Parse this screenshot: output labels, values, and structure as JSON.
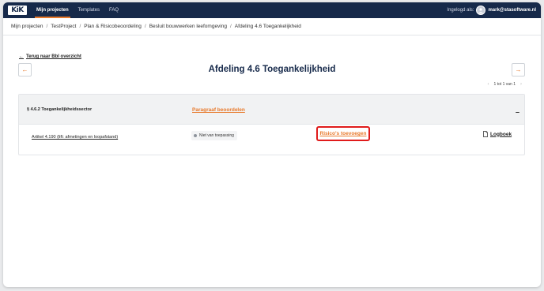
{
  "topbar": {
    "logo": "KiK",
    "nav": [
      {
        "label": "Mijn projecten",
        "active": true
      },
      {
        "label": "Templates",
        "active": false
      },
      {
        "label": "FAQ",
        "active": false
      }
    ],
    "logged_in_label": "Ingelogd als:",
    "user_email": "mark@stasoftware.nl"
  },
  "breadcrumb": [
    "Mijn projecten",
    "TestProject",
    "Plan & Risicobeoordeling",
    "Besluit bouwwerken leefomgeving",
    "Afdeling 4.6 Toegankelijkheid"
  ],
  "back_link": "Terug naar Bbl overzicht",
  "page_title": "Afdeling 4.6 Toegankelijkheid",
  "pager": {
    "text": "1 tot 1 van 1"
  },
  "section": {
    "title": "§ 4.6.2 Toegankelijkheidssector",
    "assess_link": "Paragraaf beoordelen",
    "collapse_symbol": "–",
    "rows": [
      {
        "article": "Artikel 4.190 (lift: afmetingen en loopafstand)",
        "status": "Niet van toepassing",
        "risk_button": "Risico's toevoegen",
        "log_label": "Logboek"
      }
    ]
  },
  "colors": {
    "accent": "#e8792b",
    "navbar": "#16294a",
    "highlight": "#e01b1b"
  },
  "icons": {
    "back": "arrow-left-icon",
    "prev": "arrow-left-icon",
    "next": "arrow-right-icon",
    "log": "document-icon",
    "status": "dot-icon"
  }
}
